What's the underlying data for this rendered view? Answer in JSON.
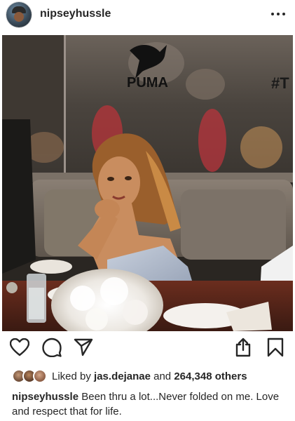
{
  "post": {
    "username": "nipseyhussle",
    "more_icon": "more-horizontal-icon"
  },
  "photo": {
    "description_icon": "post-photo",
    "wall_text": "#T",
    "brand_text": "PUMA"
  },
  "actions": {
    "like_icon": "heart-icon",
    "comment_icon": "comment-icon",
    "share_icon": "paper-plane-icon",
    "upload_icon": "share-upload-icon",
    "save_icon": "bookmark-icon"
  },
  "likes": {
    "prefix": "Liked by ",
    "user": "jas.dejanae",
    "middle": " and ",
    "count": "264,348 others"
  },
  "caption": {
    "username": "nipseyhussle",
    "text": "Been thru a lot...Never folded on me. Love and respect that for life."
  }
}
